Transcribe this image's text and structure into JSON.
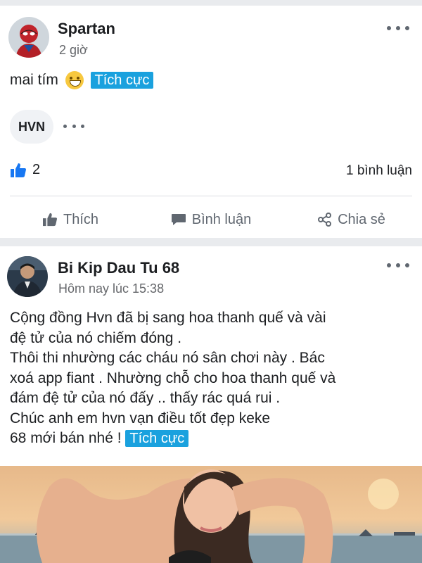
{
  "post1": {
    "author": "Spartan",
    "time": "2 giờ",
    "text": "mai tím",
    "tag": "Tích cực",
    "chip_label": "HVN",
    "like_count": "2",
    "comment_count": "1 bình luận",
    "actions": {
      "like": "Thích",
      "comment": "Bình luận",
      "share": "Chia sẻ"
    }
  },
  "post2": {
    "author": "Bi Kip Dau Tu 68",
    "time": "Hôm nay lúc 15:38",
    "lines": [
      "Cộng đồng Hvn đã bị sang hoa thanh quế và vài",
      "đệ tử của nó chiếm đóng .",
      "Thôi thi nhường các cháu nó sân chơi này . Bác",
      "xoá app fiant . Nhường chỗ cho hoa thanh quế và",
      "đám đệ tử của nó đấy .. thấy rác quá rui .",
      "Chúc anh em hvn vạn điều tốt đẹp keke"
    ],
    "last_line": "68 mới bán nhé !",
    "tag": "Tích cực"
  },
  "colors": {
    "tag_bg": "#1aa1de",
    "like_blue": "#1877f2",
    "muted": "#65676b"
  }
}
